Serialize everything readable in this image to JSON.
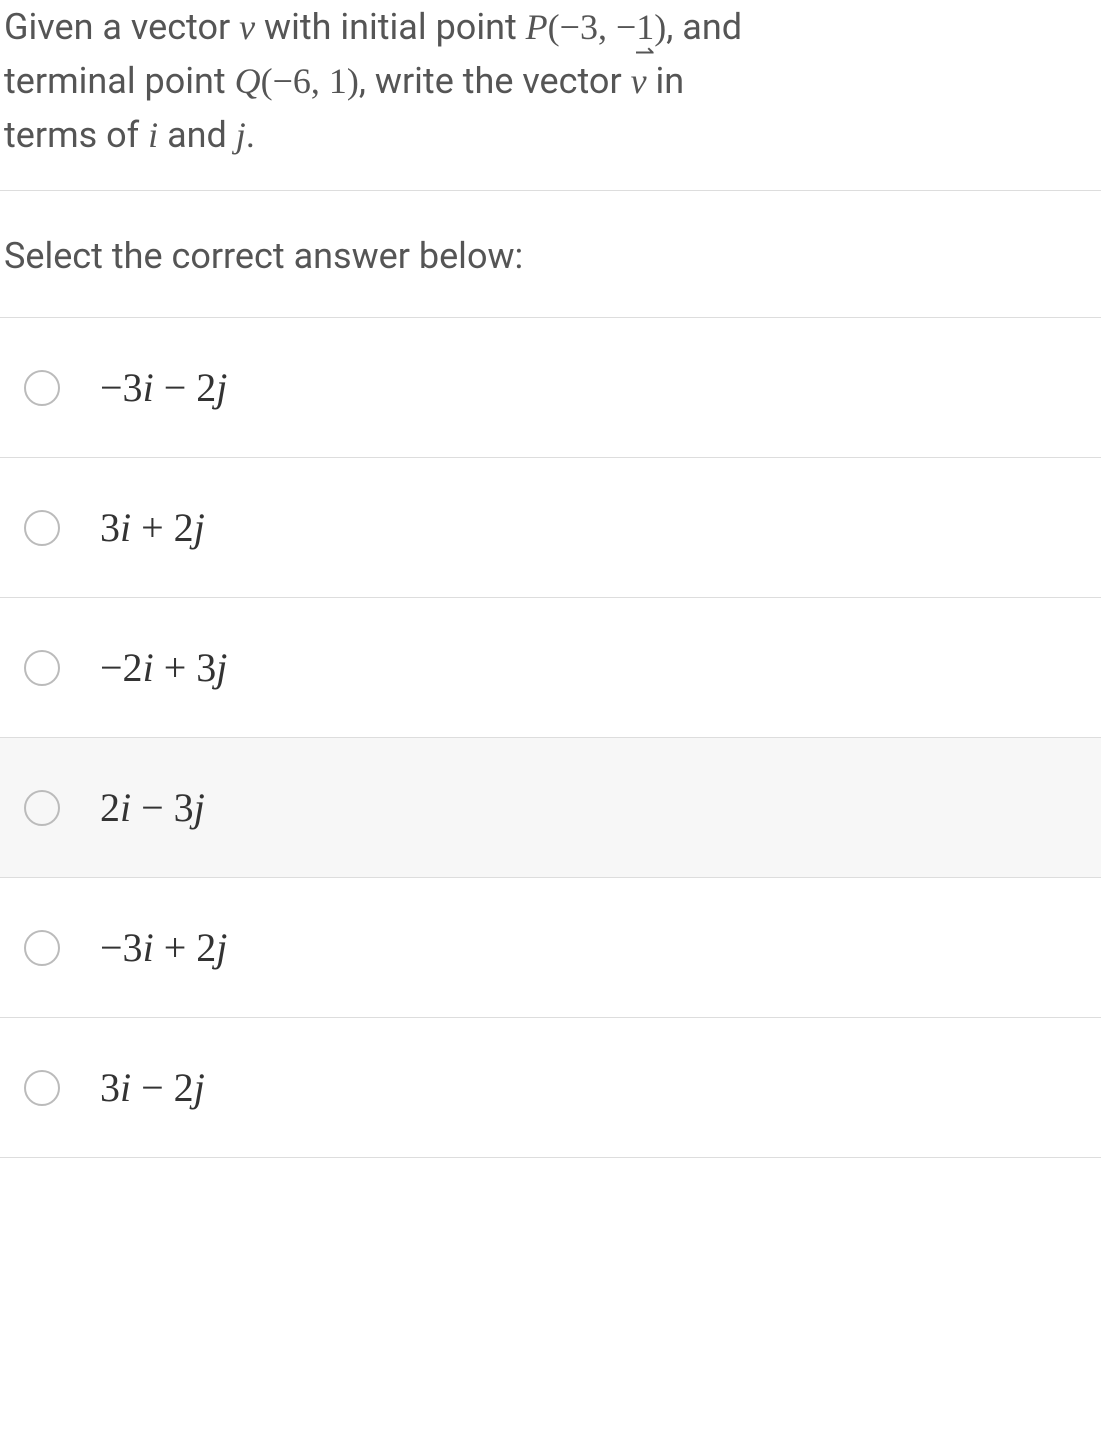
{
  "question": {
    "line_prefix_1": "Given a vector ",
    "v_sym": "v",
    "seg_1": "with initial point ",
    "P": "P",
    "P_coords": "(−3, −1)",
    "seg_2": ", and",
    "line2_a": "terminal point ",
    "Q": "Q",
    "Q_coords": "(−6, 1)",
    "seg_3": ", write the vector ",
    "seg_4": "in",
    "line3_a": "terms of ",
    "i": "i",
    "and": " and ",
    "j": "j",
    "period": "."
  },
  "prompt": "Select the correct answer below:",
  "options": [
    {
      "text": "−3i − 2j",
      "highlighted": false
    },
    {
      "text": "3i + 2j",
      "highlighted": false
    },
    {
      "text": "−2i + 3j",
      "highlighted": false
    },
    {
      "text": "2i − 3j",
      "highlighted": true
    },
    {
      "text": "−3i + 2j",
      "highlighted": false
    },
    {
      "text": "3i − 2j",
      "highlighted": false
    }
  ]
}
